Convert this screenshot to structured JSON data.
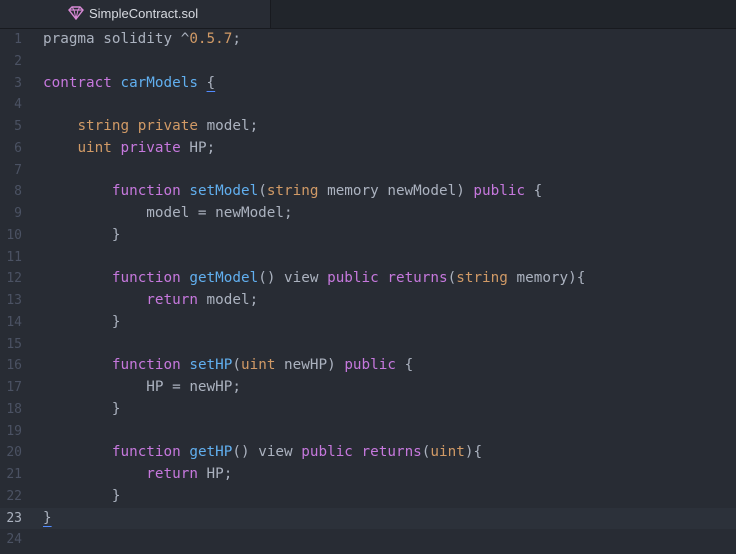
{
  "tab": {
    "title": "SimpleContract.sol",
    "icon": "solidity-diamond-icon"
  },
  "colors": {
    "background": "#282c34",
    "keyword": "#c678dd",
    "function": "#61afef",
    "type": "#e5c07b",
    "number": "#d19a66",
    "plain": "#abb2bf"
  },
  "editor": {
    "cursor_line": 23,
    "lines": [
      {
        "num": "1",
        "tokens": [
          [
            "pl",
            "pragma solidity ^"
          ],
          [
            "num",
            "0.5.7"
          ],
          [
            "pl",
            ";"
          ]
        ]
      },
      {
        "num": "2",
        "tokens": []
      },
      {
        "num": "3",
        "tokens": [
          [
            "kw",
            "contract "
          ],
          [
            "fn",
            "carModels"
          ],
          [
            "pl",
            " "
          ],
          [
            "pl ul",
            "{"
          ]
        ]
      },
      {
        "num": "4",
        "tokens": []
      },
      {
        "num": "5",
        "tokens": [
          [
            "pl",
            "    "
          ],
          [
            "ty2",
            "string"
          ],
          [
            "pl",
            " "
          ],
          [
            "ty2",
            "private"
          ],
          [
            "pl",
            " model;"
          ]
        ]
      },
      {
        "num": "6",
        "tokens": [
          [
            "pl",
            "    "
          ],
          [
            "ty2",
            "uint"
          ],
          [
            "pl",
            " "
          ],
          [
            "kw",
            "private"
          ],
          [
            "pl",
            " HP;"
          ]
        ]
      },
      {
        "num": "7",
        "tokens": []
      },
      {
        "num": "8",
        "tokens": [
          [
            "pl",
            "        "
          ],
          [
            "kw",
            "function "
          ],
          [
            "fn",
            "setModel"
          ],
          [
            "pl",
            "("
          ],
          [
            "ty2",
            "string"
          ],
          [
            "pl",
            " memory newModel) "
          ],
          [
            "kw",
            "public"
          ],
          [
            "pl",
            " {"
          ]
        ]
      },
      {
        "num": "9",
        "tokens": [
          [
            "pl",
            "            model = newModel;"
          ]
        ]
      },
      {
        "num": "10",
        "tokens": [
          [
            "pl",
            "        }"
          ]
        ]
      },
      {
        "num": "11",
        "tokens": []
      },
      {
        "num": "12",
        "tokens": [
          [
            "pl",
            "        "
          ],
          [
            "kw",
            "function "
          ],
          [
            "fn",
            "getModel"
          ],
          [
            "pl",
            "() view "
          ],
          [
            "kw",
            "public"
          ],
          [
            "pl",
            " "
          ],
          [
            "kw",
            "returns"
          ],
          [
            "pl",
            "("
          ],
          [
            "ty2",
            "string"
          ],
          [
            "pl",
            " memory){"
          ]
        ]
      },
      {
        "num": "13",
        "tokens": [
          [
            "pl",
            "            "
          ],
          [
            "kw",
            "return"
          ],
          [
            "pl",
            " model;"
          ]
        ]
      },
      {
        "num": "14",
        "tokens": [
          [
            "pl",
            "        }"
          ]
        ]
      },
      {
        "num": "15",
        "tokens": []
      },
      {
        "num": "16",
        "tokens": [
          [
            "pl",
            "        "
          ],
          [
            "kw",
            "function "
          ],
          [
            "fn",
            "setHP"
          ],
          [
            "pl",
            "("
          ],
          [
            "ty2",
            "uint"
          ],
          [
            "pl",
            " newHP) "
          ],
          [
            "kw",
            "public"
          ],
          [
            "pl",
            " {"
          ]
        ]
      },
      {
        "num": "17",
        "tokens": [
          [
            "pl",
            "            HP = newHP;"
          ]
        ]
      },
      {
        "num": "18",
        "tokens": [
          [
            "pl",
            "        }"
          ]
        ]
      },
      {
        "num": "19",
        "tokens": []
      },
      {
        "num": "20",
        "tokens": [
          [
            "pl",
            "        "
          ],
          [
            "kw",
            "function "
          ],
          [
            "fn",
            "getHP"
          ],
          [
            "pl",
            "() view "
          ],
          [
            "kw",
            "public"
          ],
          [
            "pl",
            " "
          ],
          [
            "kw",
            "returns"
          ],
          [
            "pl",
            "("
          ],
          [
            "ty2",
            "uint"
          ],
          [
            "pl",
            "){"
          ]
        ]
      },
      {
        "num": "21",
        "tokens": [
          [
            "pl",
            "            "
          ],
          [
            "kw",
            "return"
          ],
          [
            "pl",
            " HP;"
          ]
        ]
      },
      {
        "num": "22",
        "tokens": [
          [
            "pl",
            "        }"
          ]
        ]
      },
      {
        "num": "23",
        "tokens": [
          [
            "pl ul",
            "}"
          ]
        ]
      },
      {
        "num": "24",
        "tokens": []
      }
    ]
  }
}
